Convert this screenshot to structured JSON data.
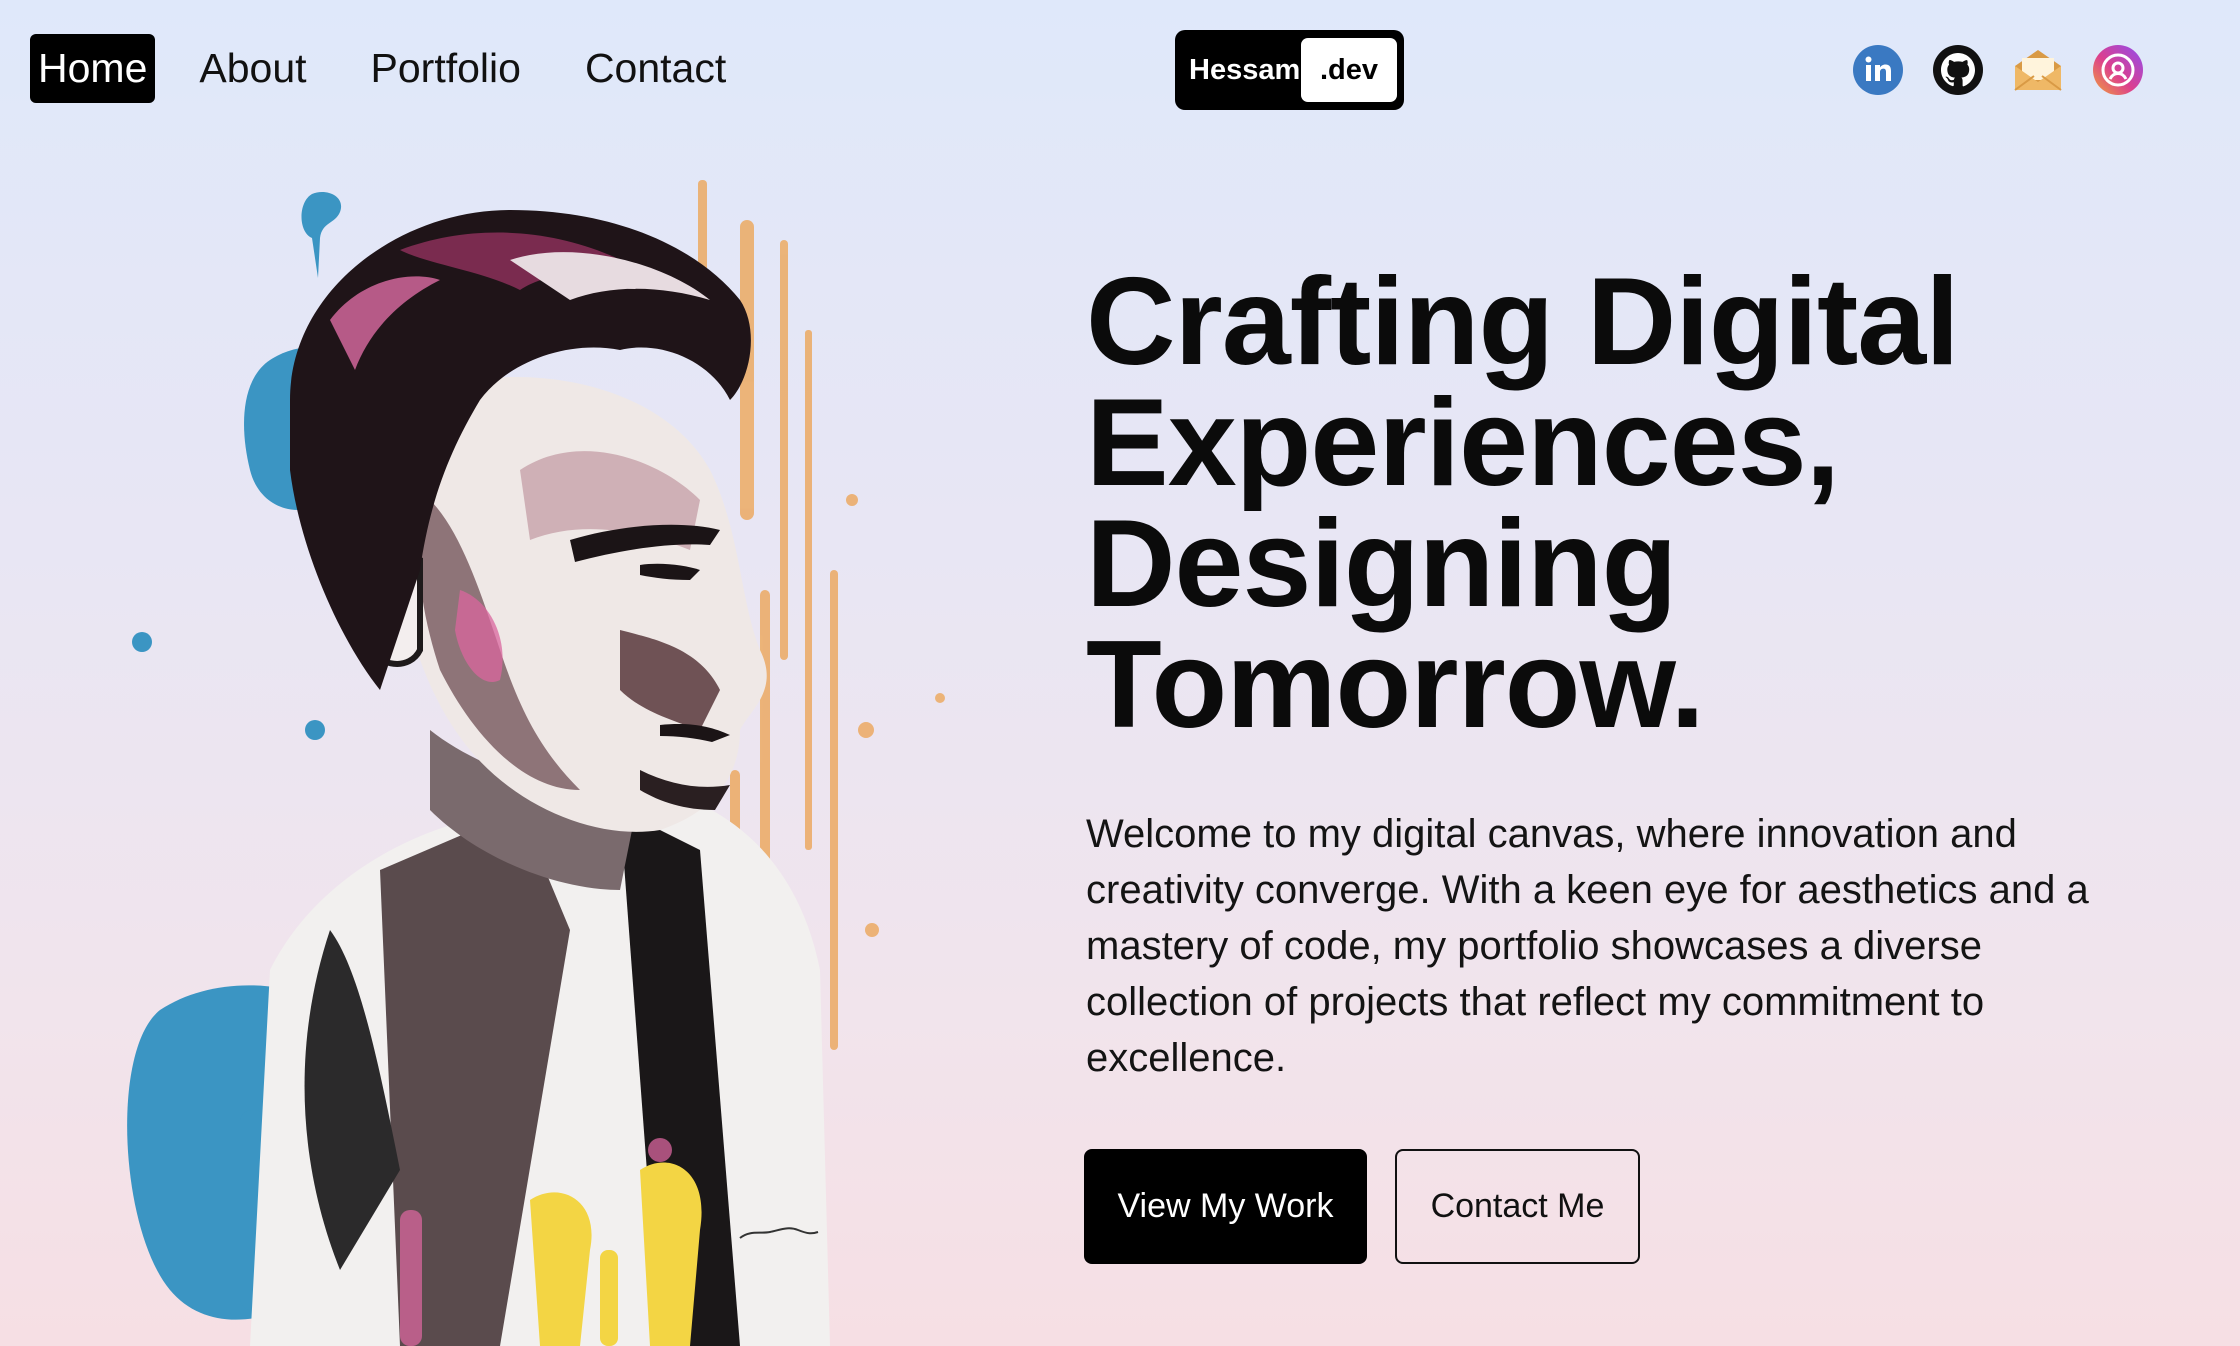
{
  "nav": {
    "items": [
      {
        "label": "Home",
        "active": true
      },
      {
        "label": "About",
        "active": false
      },
      {
        "label": "Portfolio",
        "active": false
      },
      {
        "label": "Contact",
        "active": false
      }
    ]
  },
  "logo": {
    "name": "Hessam",
    "suffix": ".dev"
  },
  "socials": [
    {
      "icon": "linkedin-icon",
      "color": "#3a79c2"
    },
    {
      "icon": "github-icon",
      "color": "#111111"
    },
    {
      "icon": "mail-icon",
      "color": "#e9ad5b"
    },
    {
      "icon": "instagram-icon",
      "color": "#c94cdb"
    }
  ],
  "hero": {
    "headline": "Crafting Digital Experiences, Designing Tomorrow.",
    "intro": "Welcome to my digital canvas, where innovation and creativity converge. With a keen eye for aesthetics and a mastery of code, my portfolio showcases a diverse collection of projects that reflect my commitment to excellence.",
    "primary_button": "View My Work",
    "secondary_button": "Contact Me"
  },
  "colors": {
    "accent": "#000000",
    "background_top": "#dfe8fa",
    "background_bottom": "#f6dfe4"
  }
}
